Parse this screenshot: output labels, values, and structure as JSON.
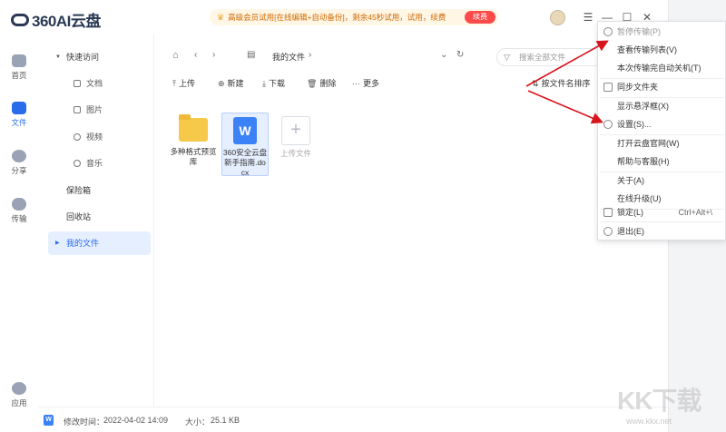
{
  "app": {
    "logo_text": "360AI云盘"
  },
  "promo": {
    "text": "高级会员试用[在线编辑+自动备份]，剩余45秒试用，试用，续费",
    "button": "续费"
  },
  "window_controls": {
    "minimize": "—",
    "maximize": "☐",
    "close": "✕"
  },
  "left_nav": [
    {
      "label": "首页"
    },
    {
      "label": "文件"
    },
    {
      "label": "分享"
    },
    {
      "label": "传输"
    },
    {
      "label": "应用"
    }
  ],
  "sidebar": {
    "quick_access": "快速访问",
    "sub_items": [
      "文档",
      "图片",
      "视频",
      "音乐"
    ],
    "safe_box": "保险箱",
    "recycle_bin": "回收站",
    "my_files": "我的文件"
  },
  "breadcrumb": {
    "current": "我的文件"
  },
  "search": {
    "placeholder": "搜索全部文件"
  },
  "toolbar": {
    "upload": "上传",
    "new": "新建",
    "download": "下载",
    "delete": "删除",
    "more": "更多",
    "sort": "按文件名排序"
  },
  "files": [
    {
      "name": "多种格式预览库",
      "type": "folder"
    },
    {
      "name": "360安全云盘新手指南.docx",
      "type": "docx"
    },
    {
      "name": "上传文件",
      "type": "upload"
    }
  ],
  "footer": {
    "modified_label": "修改时间：",
    "modified_value": "2022-04-02 14:09",
    "size_label": "大小：",
    "size_value": "25.1 KB"
  },
  "menu": {
    "items": [
      {
        "label": "暂停传输(P)",
        "disabled": true,
        "icon": "pause-icon"
      },
      {
        "label": "查看传输列表(V)"
      },
      {
        "label": "本次传输完自动关机(T)"
      },
      {
        "label": "同步文件夹",
        "icon": "sync-folder-icon"
      },
      {
        "label": "显示悬浮框(X)"
      },
      {
        "label": "设置(S)...",
        "icon": "settings-icon"
      },
      {
        "label": "打开云盘官网(W)"
      },
      {
        "label": "帮助与客服(H)"
      },
      {
        "label": "关于(A)"
      },
      {
        "label": "在线升级(U)"
      },
      {
        "label": "锁定(L)",
        "shortcut": "Ctrl+Alt+\\",
        "icon": "lock-icon"
      },
      {
        "label": "退出(E)",
        "icon": "exit-icon"
      }
    ]
  },
  "watermark": {
    "text": "KK下载",
    "url": "www.kkx.net"
  },
  "colors": {
    "accent": "#2a6bea",
    "promo_text": "#d06a00",
    "promo_button": "#ff4a4a",
    "arrow": "#d8141c"
  }
}
